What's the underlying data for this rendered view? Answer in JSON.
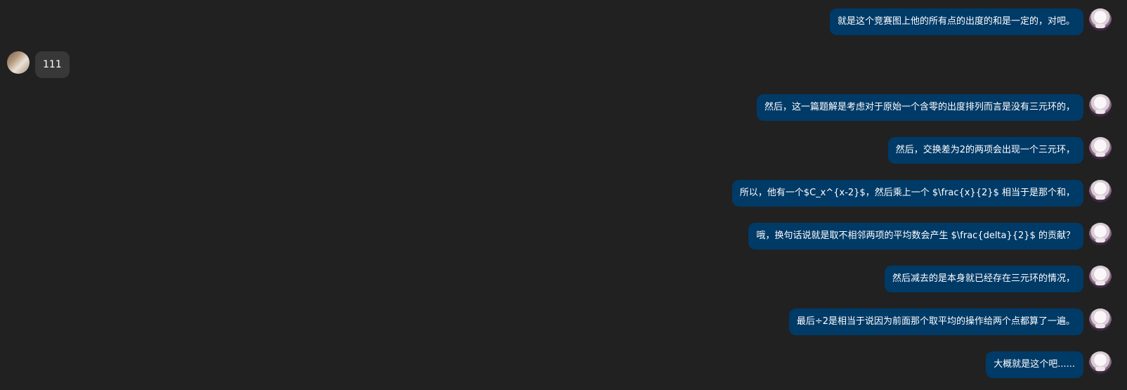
{
  "chat": {
    "messages": [
      {
        "sender": "me",
        "text": "就是这个竞赛图上他的所有点的出度的和是一定的，对吧。"
      },
      {
        "sender": "other",
        "text": "111"
      },
      {
        "sender": "me",
        "text": "然后，这一篇题解是考虑对于原始一个含零的出度排列而言是没有三元环的，"
      },
      {
        "sender": "me",
        "text": "然后，交换差为2的两项会出现一个三元环，"
      },
      {
        "sender": "me",
        "text": "所以，他有一个$C_x^{x-2}$，然后乘上一个 $\\frac{x}{2}$ 相当于是那个和，"
      },
      {
        "sender": "me",
        "text": "哦，换句话说就是取不相邻两项的平均数会产生 $\\frac{delta}{2}$ 的贡献？"
      },
      {
        "sender": "me",
        "text": "然后减去的是本身就已经存在三元环的情况，"
      },
      {
        "sender": "me",
        "text": "最后÷2是相当于说因为前面那个取平均的操作给两个点都算了一遍。"
      },
      {
        "sender": "me",
        "text": "大概就是这个吧......"
      }
    ]
  }
}
